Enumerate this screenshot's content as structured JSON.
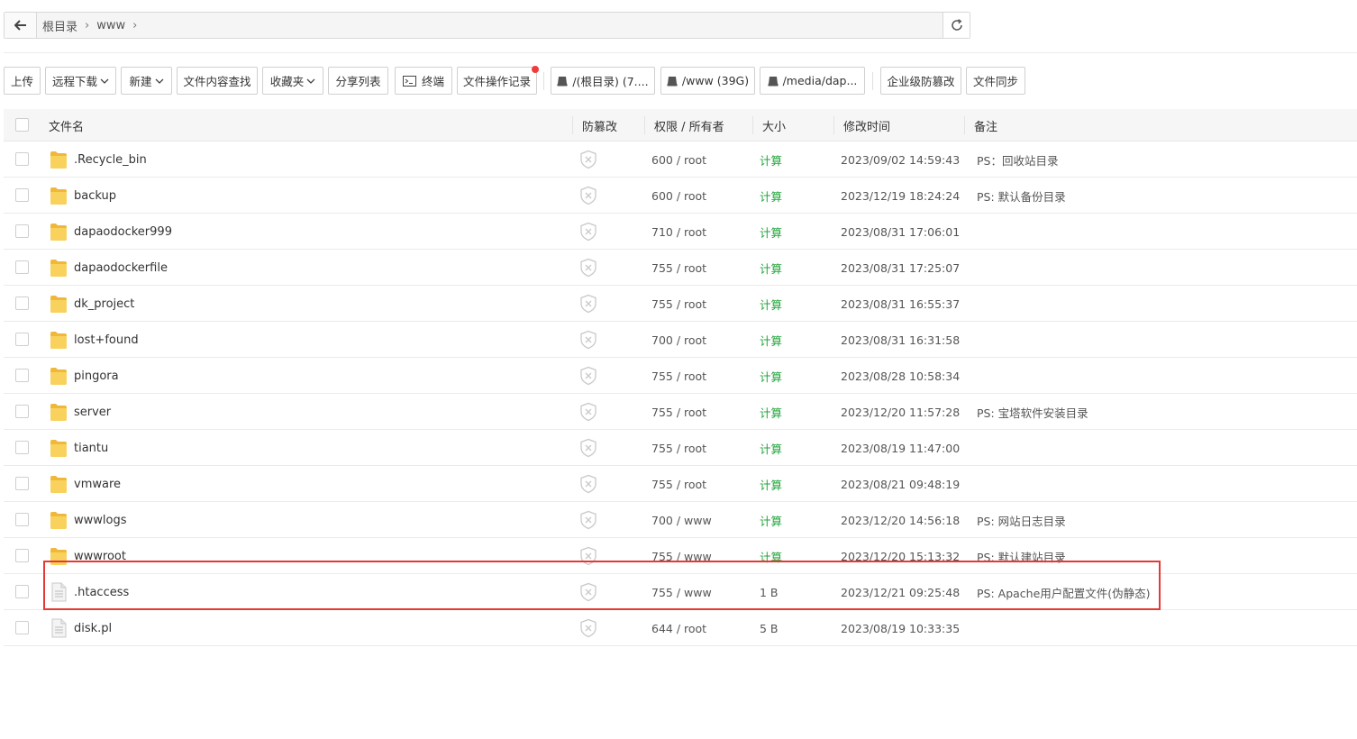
{
  "breadcrumb": {
    "items": [
      "根目录",
      "www"
    ]
  },
  "toolbar": {
    "upload": "上传",
    "remote_download": "远程下载",
    "new": "新建",
    "content_search": "文件内容查找",
    "favorites": "收藏夹",
    "share_list": "分享列表",
    "terminal": "终端",
    "op_log": "文件操作记录",
    "disk_root": "/(根目录) (7....",
    "disk_www": "/www (39G)",
    "disk_media": "/media/dap...",
    "tamper_proof": "企业级防篡改",
    "file_sync": "文件同步"
  },
  "table": {
    "headers": {
      "name": "文件名",
      "tamper": "防篡改",
      "perm": "权限 / 所有者",
      "size": "大小",
      "mtime": "修改时间",
      "note": "备注"
    },
    "rows": [
      {
        "name": ".Recycle_bin",
        "type": "folder",
        "perm": "600 / root",
        "size": "计算",
        "size_calc": true,
        "mtime": "2023/09/02 14:59:43",
        "note": "PS：回收站目录"
      },
      {
        "name": "backup",
        "type": "folder",
        "perm": "600 / root",
        "size": "计算",
        "size_calc": true,
        "mtime": "2023/12/19 18:24:24",
        "note": "PS: 默认备份目录"
      },
      {
        "name": "dapaodocker999",
        "type": "folder",
        "perm": "710 / root",
        "size": "计算",
        "size_calc": true,
        "mtime": "2023/08/31 17:06:01",
        "note": ""
      },
      {
        "name": "dapaodockerfile",
        "type": "folder",
        "perm": "755 / root",
        "size": "计算",
        "size_calc": true,
        "mtime": "2023/08/31 17:25:07",
        "note": ""
      },
      {
        "name": "dk_project",
        "type": "folder",
        "perm": "755 / root",
        "size": "计算",
        "size_calc": true,
        "mtime": "2023/08/31 16:55:37",
        "note": ""
      },
      {
        "name": "lost+found",
        "type": "folder",
        "perm": "700 / root",
        "size": "计算",
        "size_calc": true,
        "mtime": "2023/08/31 16:31:58",
        "note": ""
      },
      {
        "name": "pingora",
        "type": "folder",
        "perm": "755 / root",
        "size": "计算",
        "size_calc": true,
        "mtime": "2023/08/28 10:58:34",
        "note": ""
      },
      {
        "name": "server",
        "type": "folder",
        "perm": "755 / root",
        "size": "计算",
        "size_calc": true,
        "mtime": "2023/12/20 11:57:28",
        "note": "PS: 宝塔软件安装目录"
      },
      {
        "name": "tiantu",
        "type": "folder",
        "perm": "755 / root",
        "size": "计算",
        "size_calc": true,
        "mtime": "2023/08/19 11:47:00",
        "note": ""
      },
      {
        "name": "vmware",
        "type": "folder",
        "perm": "755 / root",
        "size": "计算",
        "size_calc": true,
        "mtime": "2023/08/21 09:48:19",
        "note": ""
      },
      {
        "name": "wwwlogs",
        "type": "folder",
        "perm": "700 / www",
        "size": "计算",
        "size_calc": true,
        "mtime": "2023/12/20 14:56:18",
        "note": "PS: 网站日志目录"
      },
      {
        "name": "wwwroot",
        "type": "folder",
        "perm": "755 / www",
        "size": "计算",
        "size_calc": true,
        "mtime": "2023/12/20 15:13:32",
        "note": "PS: 默认建站目录"
      },
      {
        "name": ".htaccess",
        "type": "file",
        "perm": "755 / www",
        "size": "1 B",
        "size_calc": false,
        "mtime": "2023/12/21 09:25:48",
        "note": "PS: Apache用户配置文件(伪静态)"
      },
      {
        "name": "disk.pl",
        "type": "file",
        "perm": "644 / root",
        "size": "5 B",
        "size_calc": false,
        "mtime": "2023/08/19 10:33:35",
        "note": ""
      }
    ]
  },
  "icons": {
    "back": "arrow-left-icon",
    "refresh": "refresh-icon",
    "caret": "chevron-down-icon",
    "terminal": "terminal-icon",
    "disk": "disk-icon",
    "folder": "folder-icon",
    "file": "file-icon",
    "shield": "shield-icon"
  },
  "colors": {
    "calc_green": "#20a53a",
    "highlight_red": "#e53935",
    "notify_dot": "#ef3b3b",
    "folder_yellow": "#f6c84b"
  }
}
